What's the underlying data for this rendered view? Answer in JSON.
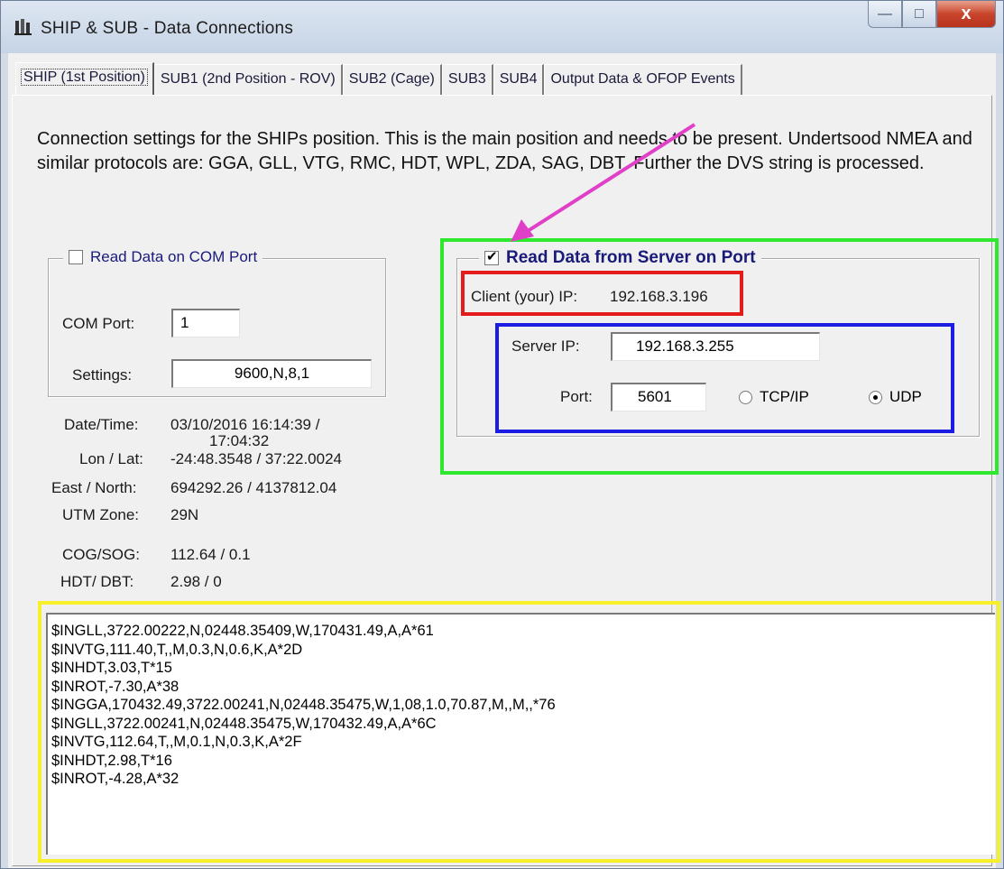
{
  "window": {
    "title": "SHIP & SUB - Data Connections",
    "minimize_glyph": "—",
    "maximize_glyph": "□",
    "close_glyph": "x"
  },
  "tabs": [
    {
      "label": "SHIP (1st Position)",
      "active": true
    },
    {
      "label": "SUB1 (2nd Position - ROV)",
      "active": false
    },
    {
      "label": "SUB2 (Cage)",
      "active": false
    },
    {
      "label": "SUB3",
      "active": false
    },
    {
      "label": "SUB4",
      "active": false
    },
    {
      "label": "Output Data & OFOP Events",
      "active": false
    }
  ],
  "description": "Connection settings for the SHIPs position. This is the main position and needs to be present. Undertsood NMEA and similar protocols are: GGA, GLL, VTG, RMC, HDT, WPL, ZDA, SAG, DBT. Further the DVS string is processed.",
  "com_group": {
    "checkbox_label": "Read Data on COM Port",
    "checked": false,
    "com_port_label": "COM Port:",
    "com_port_value": "1",
    "settings_label": "Settings:",
    "settings_value": "9600,N,8,1"
  },
  "server_group": {
    "checkbox_label": "Read Data from Server on Port",
    "checked": true,
    "client_ip_label": "Client (your) IP:",
    "client_ip_value": "192.168.3.196",
    "server_ip_label": "Server IP:",
    "server_ip_value": "192.168.3.255",
    "port_label": "Port:",
    "port_value": "5601",
    "protocol_options": [
      "TCP/IP",
      "UDP"
    ],
    "protocol_selected": "UDP"
  },
  "status": {
    "datetime_label": "Date/Time:",
    "datetime_value_1": "03/10/2016 16:14:39 /",
    "datetime_value_2": "17:04:32",
    "lonlat_label": "Lon / Lat:",
    "lonlat_value": "-24:48.3548  /  37:22.0024",
    "eastnorth_label": "East / North:",
    "eastnorth_value": "694292.26  /  4137812.04",
    "utm_label": "UTM Zone:",
    "utm_value": "29N",
    "cogsog_label": "COG/SOG:",
    "cogsog_value": "112.64  /  0.1",
    "hdtdbt_label": "HDT/ DBT:",
    "hdtdbt_value": "2.98  /  0"
  },
  "log_lines": [
    "$INGLL,3722.00222,N,02448.35409,W,170431.49,A,A*61",
    "$INVTG,111.40,T,,M,0.3,N,0.6,K,A*2D",
    "$INHDT,3.03,T*15",
    "$INROT,-7.30,A*38",
    "$INGGA,170432.49,3722.00241,N,02448.35475,W,1,08,1.0,70.87,M,,M,,*76",
    "$INGLL,3722.00241,N,02448.35475,W,170432.49,A,A*6C",
    "$INVTG,112.64,T,,M,0.1,N,0.3,K,A*2F",
    "$INHDT,2.98,T*16",
    "$INROT,-4.28,A*32"
  ],
  "annotation_colors": {
    "green": "#2ee82e",
    "red": "#e41b1b",
    "blue": "#1b1be4",
    "yellow": "#f6f02a",
    "arrow": "#e040c8"
  }
}
